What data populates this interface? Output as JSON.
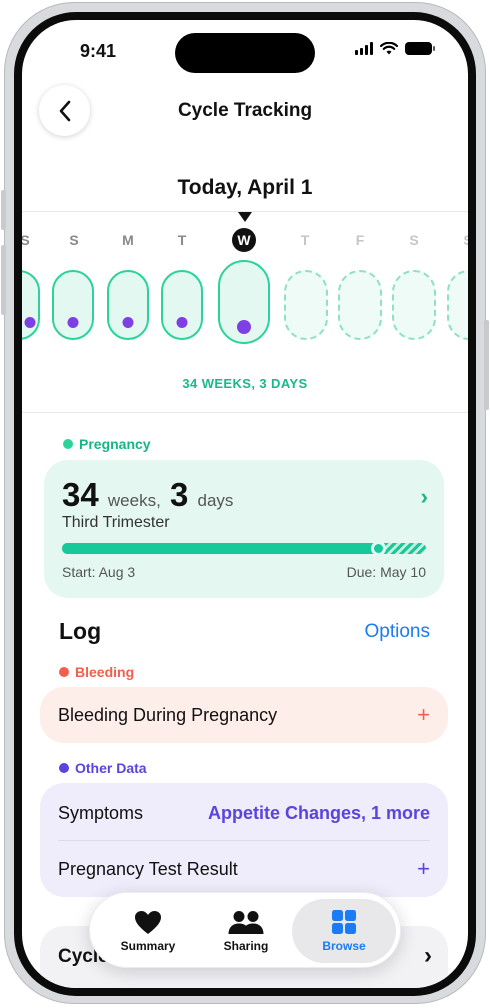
{
  "status": {
    "time": "9:41"
  },
  "nav": {
    "title": "Cycle Tracking"
  },
  "calendar": {
    "date_title": "Today, April 1",
    "days": [
      {
        "letter": "S"
      },
      {
        "letter": "S"
      },
      {
        "letter": "M"
      },
      {
        "letter": "T"
      },
      {
        "letter": "W"
      },
      {
        "letter": "T"
      },
      {
        "letter": "F"
      },
      {
        "letter": "S"
      },
      {
        "letter": "S"
      }
    ],
    "weeks_label": "34 WEEKS, 3 DAYS"
  },
  "pregnancy": {
    "section_label": "Pregnancy",
    "weeks_value": "34",
    "weeks_unit": "weeks,",
    "days_value": "3",
    "days_unit": "days",
    "trimester": "Third Trimester",
    "start": "Start: Aug 3",
    "due": "Due: May 10",
    "progress": 0.87
  },
  "log": {
    "title": "Log",
    "options": "Options",
    "bleeding_label": "Bleeding",
    "bleeding_row": "Bleeding During Pregnancy",
    "other_label": "Other Data",
    "symptoms_label": "Symptoms",
    "symptoms_value": "Appetite Changes, 1 more",
    "test_label": "Pregnancy Test Result"
  },
  "cycle_factors": {
    "label": "Cycle Factors"
  },
  "tabs": [
    {
      "label": "Summary",
      "icon": "heart-icon"
    },
    {
      "label": "Sharing",
      "icon": "people-icon"
    },
    {
      "label": "Browse",
      "icon": "grid-icon"
    }
  ],
  "colors": {
    "accent_green": "#17c99a",
    "bleeding_red": "#f0604c",
    "other_purple": "#5b43dc",
    "link_blue": "#1a7cf5"
  }
}
